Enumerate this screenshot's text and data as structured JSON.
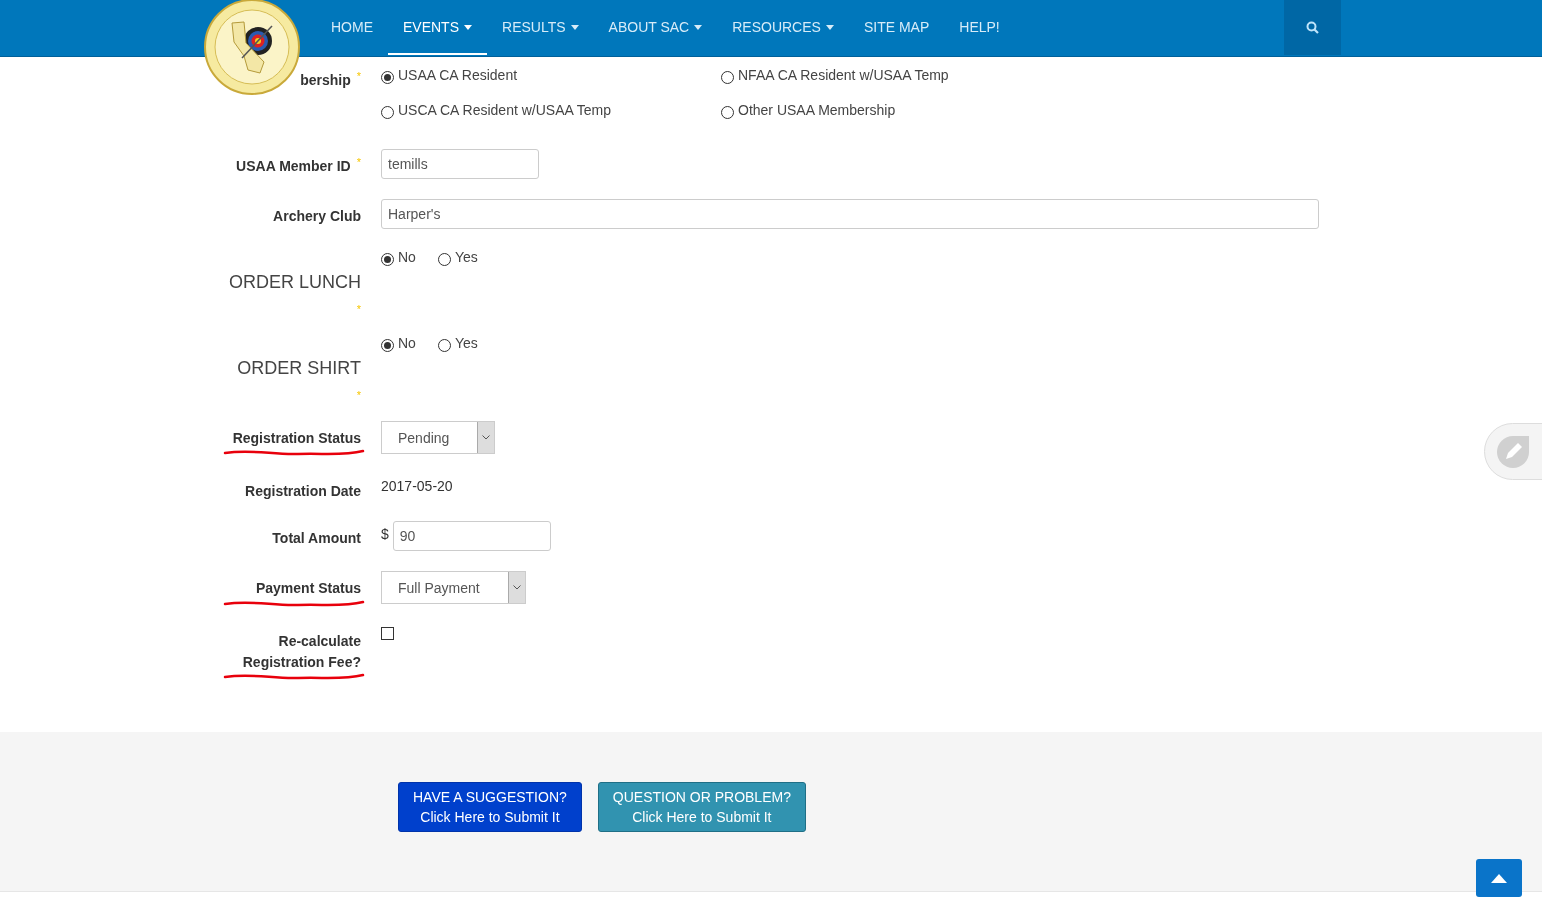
{
  "nav": {
    "items": [
      {
        "label": "HOME",
        "selected": false,
        "dropdown": false
      },
      {
        "label": "EVENTS",
        "selected": true,
        "dropdown": true
      },
      {
        "label": "RESULTS",
        "selected": false,
        "dropdown": true
      },
      {
        "label": "ABOUT SAC",
        "selected": false,
        "dropdown": true
      },
      {
        "label": "RESOURCES",
        "selected": false,
        "dropdown": true
      },
      {
        "label": "SITE MAP",
        "selected": false,
        "dropdown": false
      },
      {
        "label": "HELP!",
        "selected": false,
        "dropdown": false
      }
    ]
  },
  "form": [
    {
      "kind": "radiogrid",
      "label": "bership",
      "required_mark": "*",
      "options": [
        {
          "label": "USAA CA Resident",
          "selected": true
        },
        {
          "label": "NFAA CA Resident w/USAA Temp",
          "selected": false
        },
        {
          "label": "USCA CA Resident w/USAA Temp",
          "selected": false
        },
        {
          "label": "Other USAA Membership",
          "selected": false
        }
      ]
    },
    {
      "kind": "input",
      "label": "USAA Member ID",
      "required_mark": "*",
      "value": "temills"
    },
    {
      "kind": "wide_input",
      "label": "Archery Club",
      "value": "Harper's"
    },
    {
      "kind": "radios",
      "label": "ORDER LUNCH",
      "required_mark": "*",
      "options": [
        {
          "label": "No",
          "selected": true
        },
        {
          "label": "Yes",
          "selected": false
        }
      ]
    },
    {
      "kind": "radios",
      "label": "ORDER SHIRT",
      "required_mark": "*",
      "options": [
        {
          "label": "No",
          "selected": true
        },
        {
          "label": "Yes",
          "selected": false
        }
      ]
    },
    {
      "kind": "select",
      "label": "Registration Status",
      "underlined": true,
      "value": "Pending"
    },
    {
      "kind": "text",
      "label": "Registration Date",
      "value": "2017-05-20"
    },
    {
      "kind": "money",
      "label": "Total Amount",
      "prefix": "$",
      "value": "90"
    },
    {
      "kind": "select",
      "label": "Payment Status",
      "underlined": true,
      "value": "Full Payment"
    },
    {
      "kind": "checkbox",
      "label": "Re-calculate Registration Fee?",
      "underlined": true,
      "checked": false
    }
  ],
  "footer": {
    "buttons": [
      {
        "kind": "primary",
        "line1": "HAVE A SUGGESTION?",
        "line2": "Click Here to Submit It"
      },
      {
        "kind": "info",
        "line1": "QUESTION OR PROBLEM?",
        "line2": "Click Here to Submit It"
      }
    ]
  }
}
